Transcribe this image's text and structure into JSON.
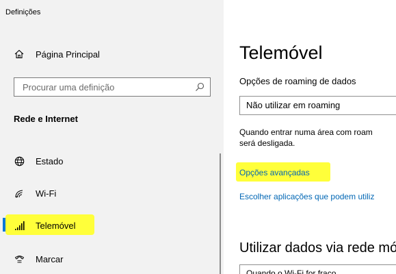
{
  "window": {
    "title": "Definições"
  },
  "sidebar": {
    "home_label": "Página Principal",
    "search_placeholder": "Procurar uma definição",
    "section_title": "Rede e Internet",
    "items": [
      {
        "label": "Estado",
        "icon": "globe-icon"
      },
      {
        "label": "Wi-Fi",
        "icon": "wifi-icon"
      },
      {
        "label": "Telemóvel",
        "icon": "cellular-signal-icon",
        "selected": true
      },
      {
        "label": "Marcar",
        "icon": "dial-up-icon"
      }
    ]
  },
  "main": {
    "title": "Telemóvel",
    "roaming_label": "Opções de roaming de dados",
    "roaming_value": "Não utilizar em roaming",
    "roaming_desc_line1": "Quando entrar numa área com roam",
    "roaming_desc_line2": "será desligada.",
    "advanced_link": "Opções avançadas",
    "apps_link": "Escolher aplicações que podem utiliz",
    "cellular_title": "Utilizar dados via rede mó",
    "cellular_value": "Quando o Wi-Fi for fraco"
  },
  "colors": {
    "accent": "#0078d7",
    "highlight": "#ffff3a",
    "link": "#0066b4",
    "sidebar_bg": "#f2f2f2"
  }
}
